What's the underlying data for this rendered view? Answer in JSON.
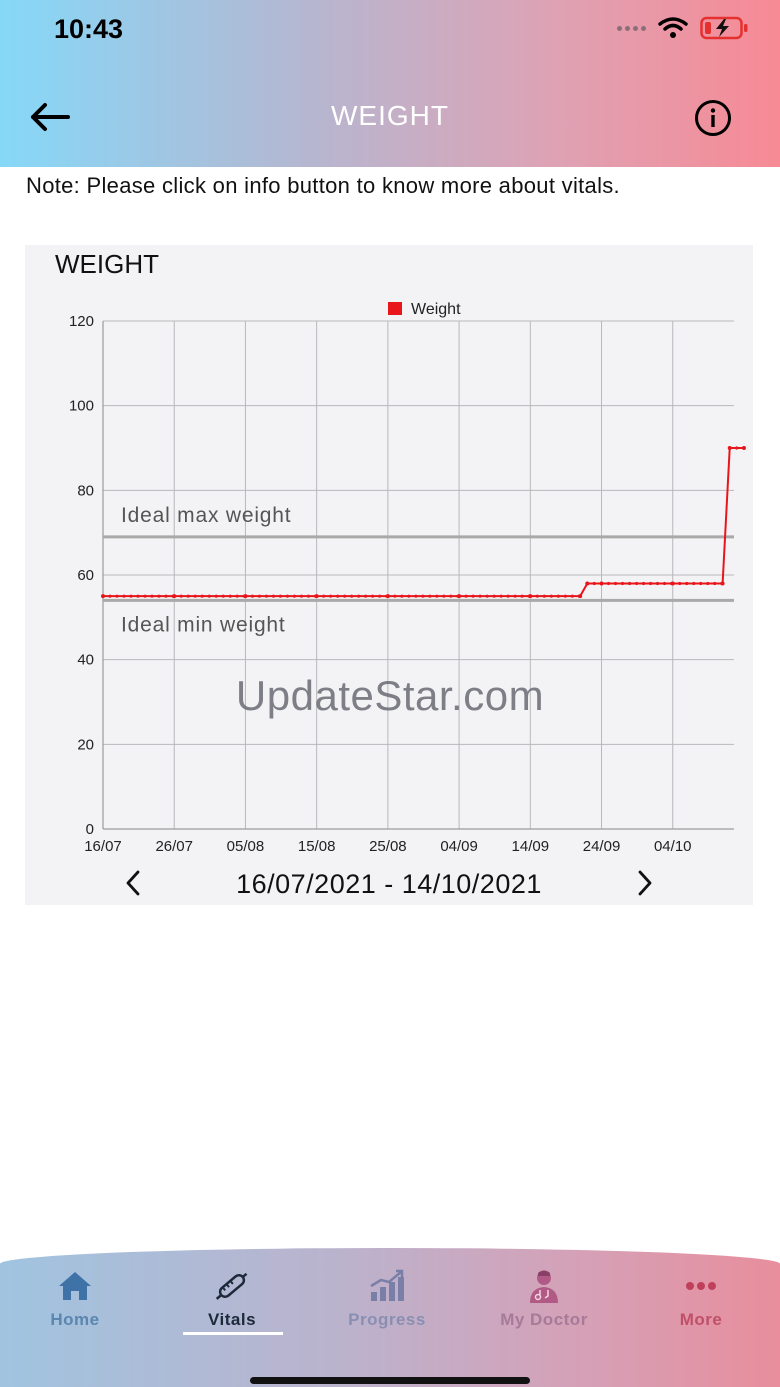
{
  "status_bar": {
    "time": "10:43"
  },
  "header": {
    "title": "WEIGHT",
    "back_icon": "arrow-left-icon",
    "info_icon": "info-circle-icon"
  },
  "note": "Note: Please click on info button to know more about vitals.",
  "chart_card": {
    "title": "WEIGHT",
    "date_range": "16/07/2021 - 14/10/2021",
    "prev_icon": "chevron-left-icon",
    "next_icon": "chevron-right-icon"
  },
  "chart_data": {
    "type": "line",
    "series": [
      {
        "name": "Weight",
        "color": "#e8151b",
        "points": [
          [
            "16/07",
            55
          ],
          [
            "26/07",
            55
          ],
          [
            "05/08",
            55
          ],
          [
            "15/08",
            55
          ],
          [
            "25/08",
            55
          ],
          [
            "04/09",
            55
          ],
          [
            "14/09",
            55
          ],
          [
            "21/09",
            55
          ],
          [
            "22/09",
            58
          ],
          [
            "24/09",
            58
          ],
          [
            "04/10",
            58
          ],
          [
            "11/10",
            58
          ],
          [
            "12/10",
            90
          ],
          [
            "14/10",
            90
          ]
        ]
      }
    ],
    "x_tick_labels": [
      "16/07",
      "26/07",
      "05/08",
      "15/08",
      "25/08",
      "04/09",
      "14/09",
      "24/09",
      "04/10"
    ],
    "x_range": [
      "16/07",
      "14/10"
    ],
    "y_ticks": [
      0,
      20,
      40,
      60,
      80,
      100,
      120
    ],
    "ylim": [
      0,
      120
    ],
    "reference_lines": [
      {
        "label": "Ideal max weight",
        "value": 69,
        "color": "#a9a9a9"
      },
      {
        "label": "Ideal min weight",
        "value": 54,
        "color": "#a9a9a9"
      }
    ],
    "legend_position": "top-center",
    "grid": true
  },
  "watermark": "UpdateStar.com",
  "tabbar": {
    "tabs": [
      {
        "label": "Home",
        "icon": "home-icon"
      },
      {
        "label": "Vitals",
        "icon": "thermometer-icon",
        "active": true
      },
      {
        "label": "Progress",
        "icon": "bar-chart-icon"
      },
      {
        "label": "My Doctor",
        "icon": "doctor-icon"
      },
      {
        "label": "More",
        "icon": "more-dots-icon"
      }
    ]
  }
}
